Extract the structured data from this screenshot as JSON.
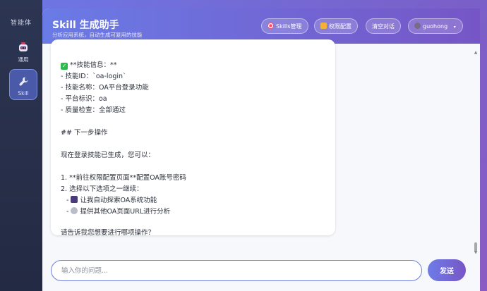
{
  "rail": {
    "title": "智能体",
    "items": [
      {
        "label": "通用",
        "icon": "robot-icon"
      },
      {
        "label": "Skill",
        "icon": "wrench-icon"
      }
    ]
  },
  "header": {
    "title": "Skill 生成助手",
    "subtitle": "分析应用系统，自动生成可复用的技能",
    "buttons": {
      "skills": "Skills管理",
      "permissions": "权限配置",
      "clear": "清空对话",
      "user": "guohong"
    }
  },
  "message": {
    "lines": [
      "**技能信息：**",
      "- 技能ID：`oa-login`",
      "- 技能名称：OA平台登录功能",
      "- 平台标识：oa",
      "- 质量检查：全部通过",
      "## 下一步操作",
      "现在登录技能已生成，您可以：",
      "1. **前往权限配置页面**配置OA账号密码",
      "2. 选择以下选项之一继续：",
      "让我自动探索OA系统功能",
      "提供其他OA页面URL进行分析",
      "请告诉我您想要进行哪项操作？"
    ],
    "bullet_prefix": "- "
  },
  "input": {
    "placeholder": "输入你的问题..."
  },
  "send_label": "发送",
  "colors": {
    "accent": "#6d7ce8",
    "accent2": "#7856c6",
    "rail": "#2c3552",
    "check": "#2fb84f"
  }
}
